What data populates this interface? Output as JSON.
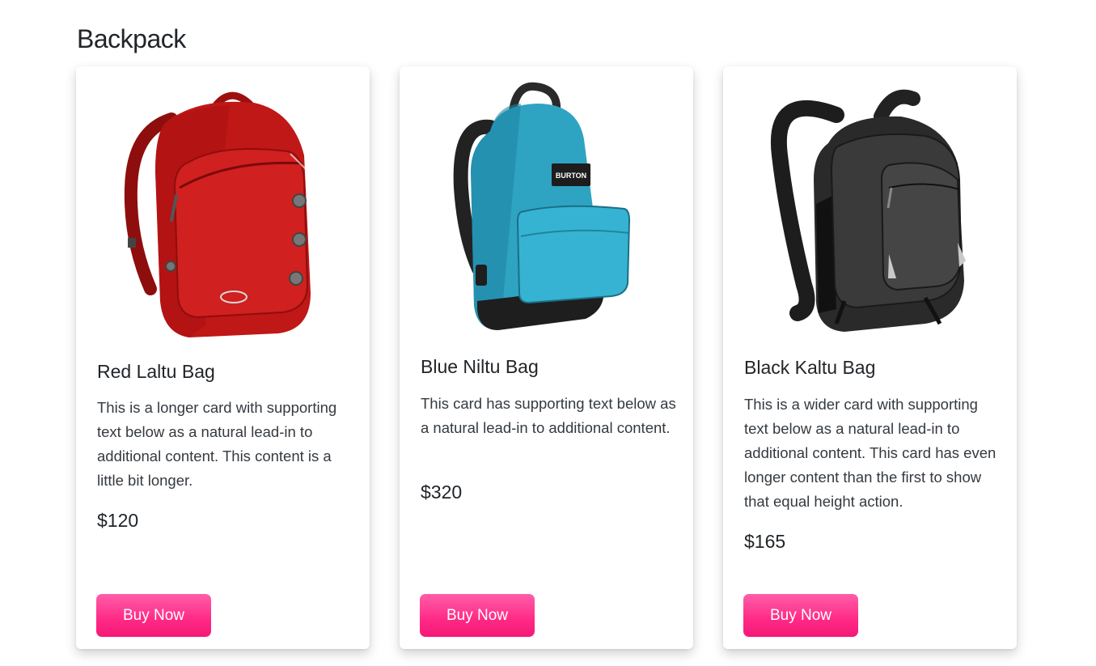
{
  "page": {
    "title": "Backpack"
  },
  "colors": {
    "accent": "#ff2a85",
    "text": "#212529"
  },
  "products": [
    {
      "name": "Red Laltu Bag",
      "description": "This is a longer card with supporting text below as a natural lead-in to additional content. This content is a little bit longer.",
      "price": "$120",
      "button_label": "Buy Now",
      "image": "red-backpack"
    },
    {
      "name": "Blue Niltu Bag",
      "description": "This card has supporting text below as a natural lead-in to additional content.",
      "price": "$320",
      "button_label": "Buy Now",
      "image": "blue-backpack",
      "brand_patch": "BURTON"
    },
    {
      "name": "Black Kaltu Bag",
      "description": "This is a wider card with supporting text below as a natural lead-in to additional content. This card has even longer content than the first to show that equal height action.",
      "price": "$165",
      "button_label": "Buy Now",
      "image": "black-backpack"
    }
  ]
}
